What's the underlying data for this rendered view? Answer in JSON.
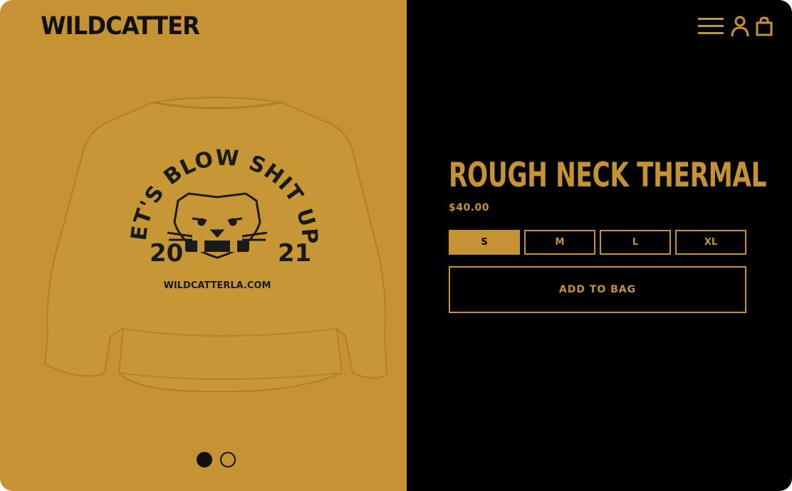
{
  "brand": {
    "logo_text": "WILDCATTER"
  },
  "colors": {
    "accent": "#c69334",
    "dark": "#000000",
    "ink": "#111111"
  },
  "header": {
    "icons": [
      "menu-icon",
      "account-icon",
      "shopping-bag-icon"
    ]
  },
  "product_image": {
    "print_arc_text": "LET'S BLOW SHIT UP!",
    "print_year_left": "20",
    "print_year_right": "21",
    "print_url": "WILDCATTERLA.COM"
  },
  "carousel": {
    "count": 2,
    "active_index": 0
  },
  "product": {
    "title": "ROUGH NECK THERMAL",
    "price": "$40.00",
    "sizes": [
      {
        "label": "S",
        "selected": true
      },
      {
        "label": "M",
        "selected": false
      },
      {
        "label": "L",
        "selected": false
      },
      {
        "label": "XL",
        "selected": false
      }
    ],
    "add_to_bag_label": "ADD TO BAG"
  }
}
